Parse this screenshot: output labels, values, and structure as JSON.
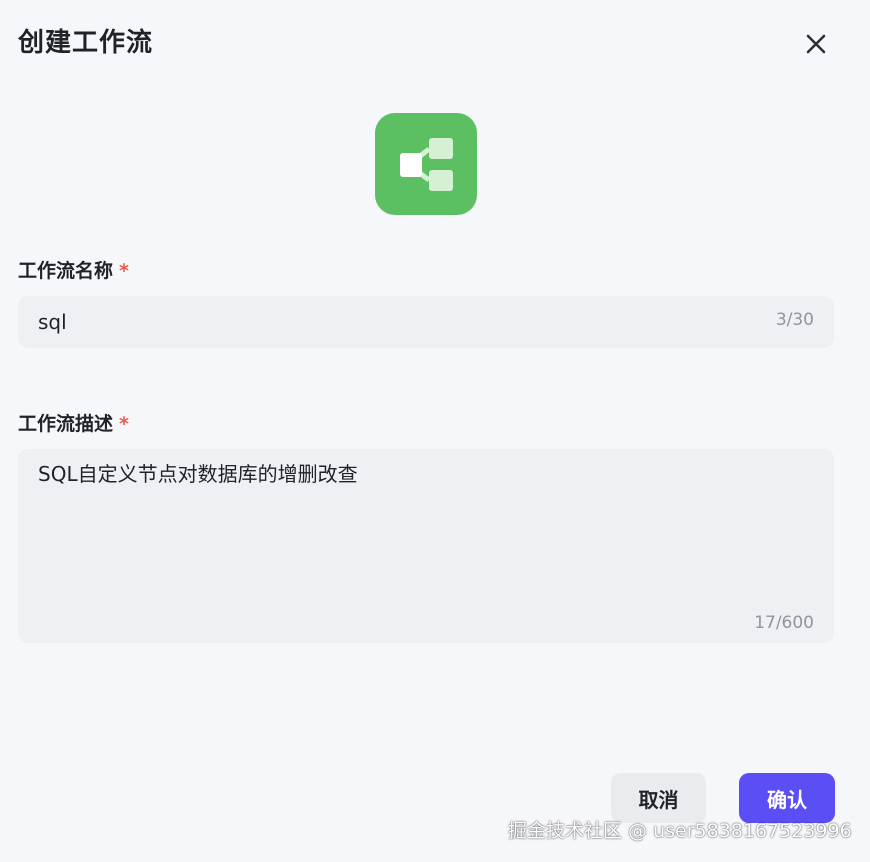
{
  "dialog": {
    "title": "创建工作流"
  },
  "icons": {
    "close": "close-icon",
    "app": "workflow-icon"
  },
  "form": {
    "name": {
      "label": "工作流名称",
      "required_mark": "*",
      "value": "sql",
      "counter": "3/30"
    },
    "description": {
      "label": "工作流描述",
      "required_mark": "*",
      "value": "SQL自定义节点对数据库的增删改查",
      "counter": "17/600"
    }
  },
  "actions": {
    "cancel_label": "取消",
    "confirm_label": "确认"
  },
  "watermark": {
    "text": "掘金技术社区 @ user5838167523996"
  },
  "colors": {
    "icon_background": "#5cc063",
    "primary": "#5b4ef5",
    "required": "#f05a4a"
  }
}
